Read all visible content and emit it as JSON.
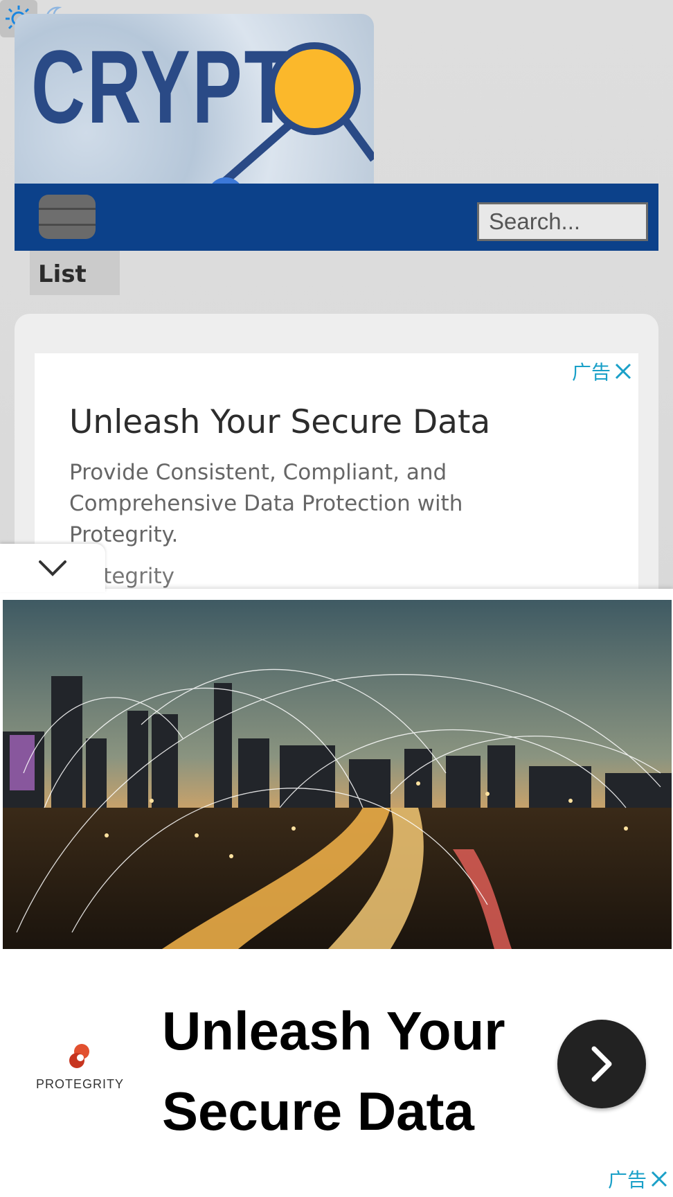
{
  "theme": {
    "light_icon": "sun-icon",
    "dark_icon": "moon-icon"
  },
  "logo": {
    "text": "CRYPT",
    "icon": "magnifier-network-icon"
  },
  "nav": {
    "menu_icon": "hamburger-icon",
    "search_placeholder": "Search..."
  },
  "list_tab": "List",
  "ad_top": {
    "label": "广告",
    "title": "Unleash Your Secure Data",
    "body": "Provide Consistent, Compliant, and Comprehensive Data Protection with Protegrity.",
    "brand": "Protegrity"
  },
  "anchor_ad": {
    "brand": "PROTEGRITY",
    "headline": "Unleash Your Secure Data",
    "label": "广告",
    "cta_icon": "chevron-right-icon",
    "collapse_icon": "chevron-down-icon"
  },
  "colors": {
    "nav": "#0c418a",
    "logo_text": "#2a4a86",
    "ad_label": "#1aa0c8"
  }
}
